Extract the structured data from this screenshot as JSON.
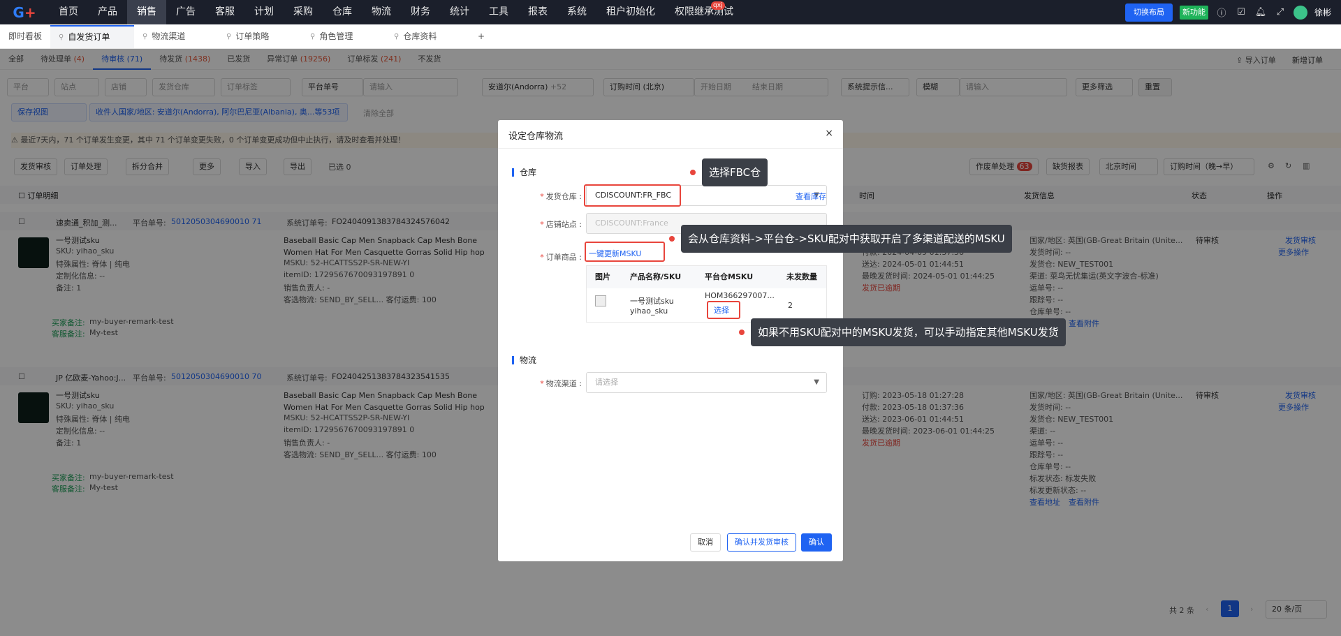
{
  "topnav": {
    "items": [
      "首页",
      "产品",
      "销售",
      "广告",
      "客服",
      "计划",
      "采购",
      "仓库",
      "物流",
      "财务",
      "统计",
      "工具",
      "报表",
      "系统",
      "租户初始化",
      "权限继承测试"
    ],
    "active_index": 2,
    "badge": "qxj",
    "switch_layout": "切换布局",
    "new_feature": "新功能",
    "user_name": "徐彬"
  },
  "tabs": {
    "dashboard": "即时看板",
    "items": [
      "自发货订单",
      "物流渠道",
      "订单策略",
      "角色管理",
      "仓库资料"
    ],
    "add": "+"
  },
  "status_tabs": [
    {
      "label": "全部",
      "count": ""
    },
    {
      "label": "待处理单",
      "count": "(4)"
    },
    {
      "label": "待审核",
      "count": "(71)"
    },
    {
      "label": "待发货",
      "count": "(1438)"
    },
    {
      "label": "已发货",
      "count": ""
    },
    {
      "label": "异常订单",
      "count": "(19256)"
    },
    {
      "label": "订单标发",
      "count": "(241)"
    },
    {
      "label": "不发货",
      "count": ""
    }
  ],
  "header_actions": {
    "import": "导入订单",
    "new": "新增订单"
  },
  "filters": {
    "platform": "平台",
    "site": "站点",
    "shop": "店铺",
    "warehouse": "发货仓库",
    "tag": "订单标签",
    "platform_no": "平台单号",
    "input_placeholder": "请输入",
    "country": "安道尔(Andorra)",
    "country_more": "+52",
    "time_type": "订购时间 (北京)",
    "start_date": "开始日期",
    "end_date": "结束日期",
    "sys_tip": "系统提示信...",
    "fuzzy": "模糊",
    "more": "更多筛选",
    "reset": "重置",
    "save_view": "保存视图",
    "recipient": "收件人国家/地区: 安道尔(Andorra), 阿尔巴尼亚(Albania), 奥...等53项",
    "clear": "清除全部"
  },
  "notice": "最近7天内，71 个订单发生变更，其中 71 个订单变更失败，0 个订单变更成功但中止执行，请及时查看并处理！",
  "toolbar": {
    "items": [
      "发货审核",
      "订单处理",
      "拆分合并",
      "更多",
      "导入",
      "导出"
    ],
    "selected": "已选 0",
    "work_orders": "作废单处理",
    "work_count": "63",
    "missing": "缺货报表",
    "timezone": "北京时间",
    "sort": "订购时间（晚→早）"
  },
  "table_headers": {
    "detail": "订单明细",
    "time": "时间",
    "shipping": "发货信息",
    "status": "状态",
    "ops": "操作"
  },
  "orders": [
    {
      "shop": "速卖通_积加_测...",
      "platform_label": "平台单号:",
      "platform_no": "5012050304690010 71",
      "sys_label": "系统订单号:",
      "sys_no": "FO2404091383784324576042",
      "product_name": "一号测试sku",
      "sku": "SKU: yihao_sku",
      "attr": "特殊属性: 脊体 | 纯电",
      "custom": "定制化信息: --",
      "note": "备注: 1",
      "title": "Baseball Basic Cap Men Snapback Cap Mesh Bone Women Hat For Men Casquette Gorras Solid Hip hop Trucker",
      "msku": "MSKU: 52-HCATTSS2P-SR-NEW-YI",
      "itemid": "itemID: 1729567670093197891 0",
      "seller": "销售负责人: -",
      "ship": "客选物流: SEND_BY_SELL...  客付运费: 100",
      "times": [
        "订购: 2024-04-09 01:37:36",
        "付款: 2024-04-09 01:37:36",
        "送达: 2024-05-01 01:44:51",
        "最晚发货时间: 2024-05-01 01:44:25"
      ],
      "overdue": "发货已逾期",
      "ship_info": [
        "国家/地区: 英国(GB-Great Britain (Unite...",
        "发货时间: --",
        "发货仓: NEW_TEST001",
        "渠道: 菜鸟无忧集运(英文字波合-标准)",
        "运单号: --",
        "跟踪号: --",
        "仓库单号: --"
      ],
      "status": "待审核",
      "op1": "发货审核",
      "op2": "更多操作",
      "buyer_remark_label": "买家备注:",
      "buyer_remark": "my-buyer-remark-test",
      "service_label": "客服备注:",
      "service": "My-test",
      "view_addr": "查看地址",
      "view_attach": "查看附件"
    },
    {
      "shop": "JP  亿欧麦-Yahoo:J...",
      "platform_label": "平台单号:",
      "platform_no": "5012050304690010 70",
      "sys_label": "系统订单号:",
      "sys_no": "FO2404251383784323541535",
      "product_name": "一号测试sku",
      "sku": "SKU: yihao_sku",
      "attr": "特殊属性: 脊体 | 纯电",
      "custom": "定制化信息: --",
      "note": "备注: 1",
      "title": "Baseball Basic Cap Men Snapback Cap Mesh Bone Women Hat For Men Casquette Gorras Solid Hip hop Trucker",
      "msku": "MSKU: 52-HCATTSS2P-SR-NEW-YI",
      "itemid": "itemID: 1729567670093197891 0",
      "seller": "销售负责人: -",
      "ship": "客选物流: SEND_BY_SELL...  客付运费: 100",
      "times": [
        "订购: 2023-05-18 01:27:28",
        "付款: 2023-05-18 01:37:36",
        "送达: 2023-06-01 01:44:51",
        "最晚发货时间: 2023-06-01 01:44:25"
      ],
      "overdue": "发货已逾期",
      "ship_info": [
        "国家/地区: 英国(GB-Great Britain (Unite...",
        "发货时间: --",
        "发货仓: NEW_TEST001",
        "渠道: --",
        "运单号: --",
        "跟踪号: --",
        "仓库单号: --",
        "标发状态: 标发失败",
        "标发更新状态: --"
      ],
      "status": "待审核",
      "op1": "发货审核",
      "op2": "更多操作",
      "buyer_remark_label": "买家备注:",
      "buyer_remark": "my-buyer-remark-test",
      "service_label": "客服备注:",
      "service": "My-test",
      "view_addr": "查看地址",
      "view_attach": "查看附件"
    }
  ],
  "pagination": {
    "total": "共 2 条",
    "page": "1",
    "size": "20 条/页"
  },
  "modal": {
    "title": "设定仓库物流",
    "close": "×",
    "section_warehouse": "仓库",
    "ship_wh_label": "发货仓库",
    "ship_wh_value": "CDISCOUNT:FR_FBC",
    "view_stock": "查看库存",
    "shop_site_label": "店铺站点",
    "shop_site_value": "CDISCOUNT:France",
    "order_goods_label": "订单商品",
    "refresh_msku": "一键更新MSKU",
    "table_headers": [
      "图片",
      "产品名称/SKU",
      "平台仓MSKU",
      "未发数量"
    ],
    "row": {
      "name": "一号测试sku",
      "sku": "yihao_sku",
      "msku": "HOM366297007...",
      "select": "选择",
      "qty": "2"
    },
    "section_logistics": "物流",
    "channel_label": "物流渠道",
    "channel_placeholder": "请选择",
    "cancel": "取消",
    "confirm_audit": "确认并发货审核",
    "confirm": "确认"
  },
  "tips": {
    "tip1": "选择FBC仓",
    "tip2": "会从仓库资料->平台仓->SKU配对中获取开启了多渠道配送的MSKU",
    "tip3": "如果不用SKU配对中的MSKU发货，可以手动指定其他MSKU发货"
  }
}
